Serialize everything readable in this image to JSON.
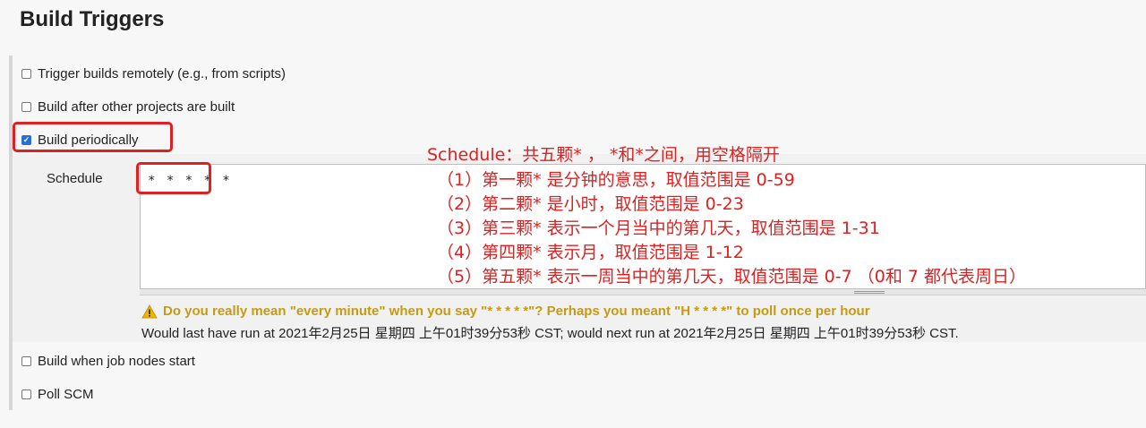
{
  "page": {
    "title": "Build Triggers"
  },
  "options": {
    "remote": "Trigger builds remotely (e.g., from scripts)",
    "after_other": "Build after other projects are built",
    "periodically": "Build periodically",
    "job_nodes_start": "Build when job nodes start",
    "poll_scm": "Poll SCM"
  },
  "schedule": {
    "label": "Schedule",
    "value": "* * * * *",
    "warning": "Do you really mean \"every minute\" when you say \"* * * * *\"? Perhaps you meant \"H * * * *\" to poll once per hour",
    "info": "Would last have run at 2021年2月25日 星期四 上午01时39分53秒 CST; would next run at 2021年2月25日 星期四 上午01时39分53秒 CST."
  },
  "annotation": {
    "header": "Schedule：共五颗* ， *和*之间，用空格隔开",
    "lines": [
      "（1）第一颗* 是分钟的意思，取值范围是 0-59",
      "（2）第二颗* 是小时，取值范围是 0-23",
      "（3）第三颗* 表示一个月当中的第几天，取值范围是 1-31",
      "（4）第四颗* 表示月，取值范围是 1-12",
      "（5）第五颗* 表示一周当中的第几天，取值范围是 0-7 （0和 7 都代表周日）"
    ]
  },
  "state": {
    "periodically_checked": true
  },
  "colors": {
    "annotation_red": "#e02020",
    "warning_gold": "#c69a12",
    "checkbox_blue": "#2b6fd6"
  },
  "icons": {
    "warning": "warning-triangle-icon",
    "checked": "checkmark-icon"
  }
}
